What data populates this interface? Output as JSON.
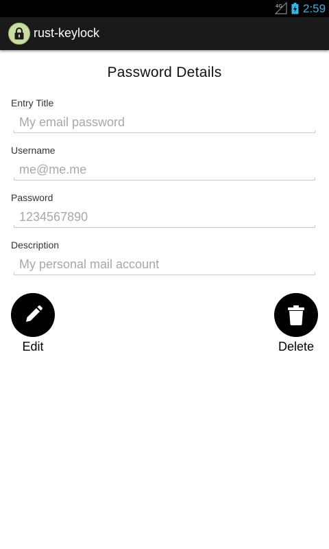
{
  "status_bar": {
    "network": "4G",
    "time": "2:59"
  },
  "action_bar": {
    "app_icon": "lock-icon",
    "title": "rust-keylock"
  },
  "page": {
    "title": "Password Details"
  },
  "fields": [
    {
      "label": "Entry Title",
      "placeholder": "My email password"
    },
    {
      "label": "Username",
      "placeholder": "me@me.me"
    },
    {
      "label": "Password",
      "placeholder": "1234567890"
    },
    {
      "label": "Description",
      "placeholder": "My personal mail account"
    }
  ],
  "actions": {
    "edit": {
      "label": "Edit",
      "icon": "pencil-icon"
    },
    "delete": {
      "label": "Delete",
      "icon": "trash-icon"
    }
  },
  "colors": {
    "status_clock": "#33b5e5",
    "action_bar_bg": "#1a1a1a",
    "app_icon_bg": "#c7dea0",
    "placeholder_text": "#a8a8a8",
    "fab_bg": "#000000"
  }
}
